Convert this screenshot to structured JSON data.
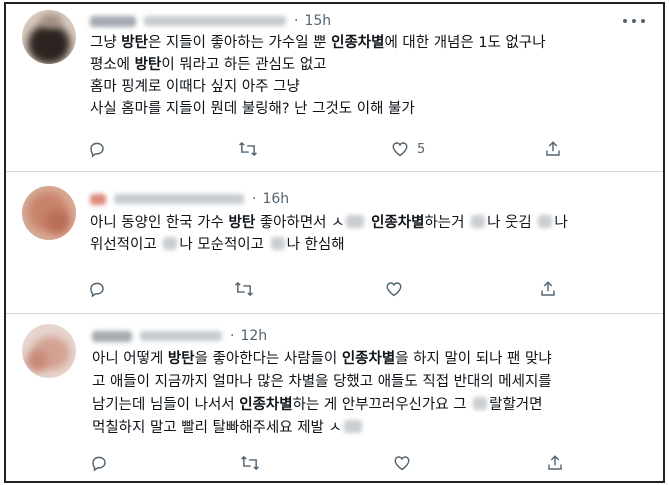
{
  "tweets": [
    {
      "time": "15h",
      "lines": [
        [
          {
            "t": "그냥 "
          },
          {
            "t": "방탄",
            "b": true
          },
          {
            "t": "은 지들이 좋아하는 가수일 뿐 "
          },
          {
            "t": "인종차별",
            "b": true
          },
          {
            "t": "에 대한 개념은 1도 없구나"
          }
        ],
        [
          {
            "t": "평소에 "
          },
          {
            "t": "방탄",
            "b": true
          },
          {
            "t": "이 뭐라고 하든 관심도 없고"
          }
        ],
        [
          {
            "t": "홈마 핑계로 이때다 싶지 아주 그냥"
          }
        ],
        [
          {
            "t": "사실 홈마를 지들이 뭔데 불링해? 난 그것도 이해 불가"
          }
        ]
      ],
      "actions": {
        "reply": "",
        "retweet": "",
        "like": "5",
        "share": ""
      }
    },
    {
      "time": "16h",
      "lines": [
        [
          {
            "t": "아니 동양인 한국 가수 "
          },
          {
            "t": "방탄",
            "b": true
          },
          {
            "t": " 좋아하면서 ㅅ"
          },
          {
            "smudge": 18
          },
          {
            "t": " "
          },
          {
            "t": "인종차별",
            "b": true
          },
          {
            "t": "하는거 "
          },
          {
            "smudge": 14
          },
          {
            "t": "나 웃김 "
          },
          {
            "smudge": 14
          },
          {
            "t": "나"
          }
        ],
        [
          {
            "t": "위선적이고 "
          },
          {
            "smudge": 14
          },
          {
            "t": "나 모순적이고 "
          },
          {
            "smudge": 14
          },
          {
            "t": "나 한심해"
          }
        ]
      ],
      "actions": {
        "reply": "",
        "retweet": "",
        "like": "",
        "share": ""
      }
    },
    {
      "time": "12h",
      "lines": [
        [
          {
            "t": "아니 어떻게 "
          },
          {
            "t": "방탄",
            "b": true
          },
          {
            "t": "을 좋아한다는 사람들이 "
          },
          {
            "t": "인종차별",
            "b": true
          },
          {
            "t": "을 하지 말이 되나 팬 맞냐"
          }
        ],
        [
          {
            "t": "고 애들이 지금까지 얼마나 많은 차별을 당했고 애들도 직접 반대의 메세지를"
          }
        ],
        [
          {
            "t": "남기는데 님들이 나서서 "
          },
          {
            "t": "인종차별",
            "b": true
          },
          {
            "t": "하는 게 안부끄러우신가요 그 "
          },
          {
            "smudge": 14
          },
          {
            "t": "랄할거면"
          }
        ],
        [
          {
            "t": "먹칠하지 말고 빨리 탈빠해주세요 제발 ㅅ"
          },
          {
            "smudge": 18
          }
        ]
      ],
      "actions": {
        "reply": "",
        "retweet": "",
        "like": "",
        "share": ""
      }
    }
  ]
}
